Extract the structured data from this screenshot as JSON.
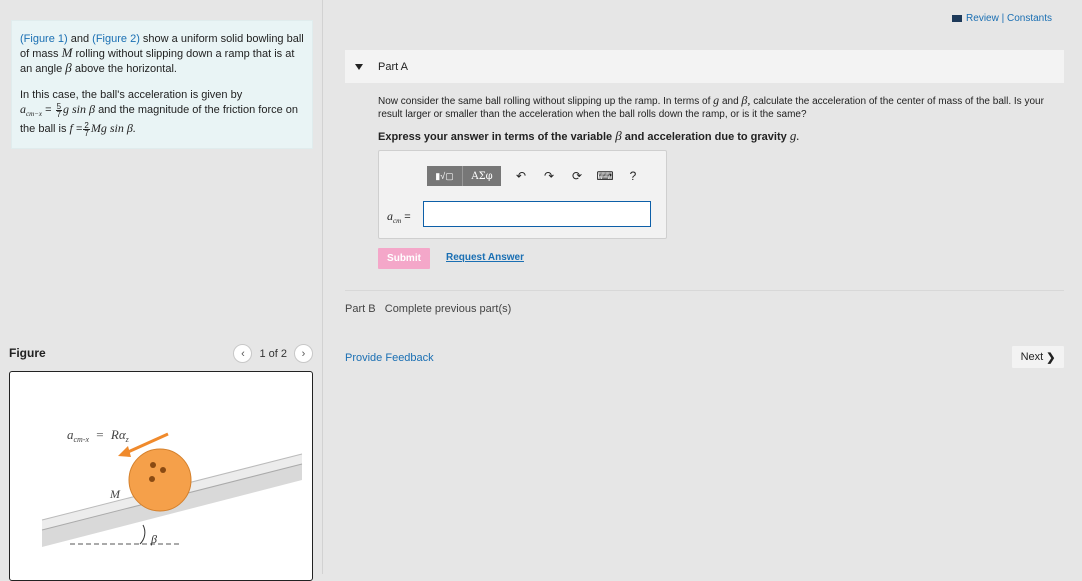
{
  "header": {
    "review_constants": "Review | Constants"
  },
  "intro": {
    "figure1_link": "(Figure 1)",
    "and": "and",
    "figure2_link": "(Figure 2)",
    "sentence_rest_1": "show a uniform solid bowling ball of mass",
    "mass_symbol": "M",
    "sentence_rest_2": "rolling without slipping down a ramp that is at an angle",
    "angle_symbol": "β",
    "sentence_rest_3": "above the horizontal.",
    "acc_intro": "In this case, the ball's acceleration is given by",
    "acc_lhs": "a",
    "acc_lhs_sub": "cm−x",
    "equals": "=",
    "acc_frac_num": "5",
    "acc_frac_den": "7",
    "acc_rhs": "g sin β",
    "friction_text": "and the magnitude of the friction force on the ball is",
    "friction_lhs": "f",
    "friction_frac_num": "2",
    "friction_frac_den": "7",
    "friction_rhs": "Mg sin β."
  },
  "figure_panel": {
    "title": "Figure",
    "pager_text": "1 of 2",
    "prev_icon": "chevron-left-icon",
    "next_icon": "chevron-right-icon",
    "diagram": {
      "top_label_lhs": "a",
      "top_label_lhs_sub": "cm-x",
      "top_label_eq": "=",
      "top_label_rhs": "Rα",
      "top_label_rhs_sub": "z",
      "mass_label": "M",
      "angle_label": "β",
      "ball_color": "#f5a04a",
      "arrow_color": "#f08a2c"
    }
  },
  "part_a": {
    "label": "Part A",
    "question_1": "Now consider the same ball rolling without slipping up the ramp. In terms of",
    "q_g": "g",
    "q_and": "and",
    "q_beta": "β,",
    "question_2": "calculate the acceleration of the center of mass of the ball. Is your result larger or smaller than the acceleration when the ball rolls down the ramp, or is it the same?",
    "instruction_prefix": "Express your answer in terms of the variable",
    "instruction_beta": "β",
    "instruction_mid": "and acceleration due to gravity",
    "instruction_g": "g.",
    "toolbar": {
      "templates_label": "▮√▢",
      "greek_label": "ΑΣφ",
      "undo_icon": "undo-icon",
      "redo_icon": "redo-icon",
      "reset_icon": "reset-icon",
      "keyboard_icon": "keyboard-icon",
      "help_label": "?"
    },
    "answer_lhs": "a",
    "answer_lhs_sub": "cm",
    "answer_equals": "=",
    "answer_value": "",
    "submit_label": "Submit",
    "request_answer_label": "Request Answer"
  },
  "part_b": {
    "label": "Part B",
    "status": "Complete previous part(s)"
  },
  "footer": {
    "provide_feedback": "Provide Feedback",
    "next_label": "Next"
  },
  "colors": {
    "link": "#1a6fb3",
    "submit_bg": "#f4a7c9",
    "intro_bg": "#e9f4f5"
  }
}
